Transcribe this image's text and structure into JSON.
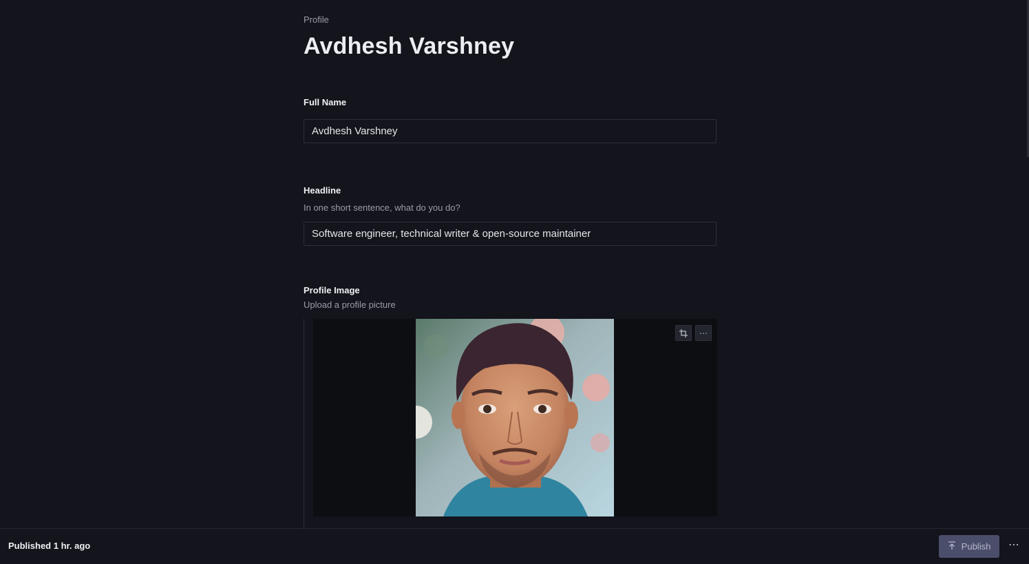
{
  "header": {
    "breadcrumb": "Profile",
    "title": "Avdhesh Varshney"
  },
  "fields": {
    "full_name": {
      "label": "Full Name",
      "value": "Avdhesh Varshney"
    },
    "headline": {
      "label": "Headline",
      "description": "In one short sentence, what do you do?",
      "value": "Software engineer, technical writer & open-source maintainer"
    },
    "profile_image": {
      "label": "Profile Image",
      "description": "Upload a profile picture",
      "tools": [
        "crop-icon",
        "more-options-icon"
      ]
    }
  },
  "footer": {
    "status_prefix": "Published",
    "status_time": "1 hr. ago",
    "publish_label": "Publish",
    "publish_icon": "publish-arrow-up-icon",
    "more_icon": "more-options-icon"
  },
  "colors": {
    "background": "#13141c",
    "input_border": "#2f313b",
    "publish_button": "#4a4e6a",
    "muted_text": "#9a9daa"
  }
}
